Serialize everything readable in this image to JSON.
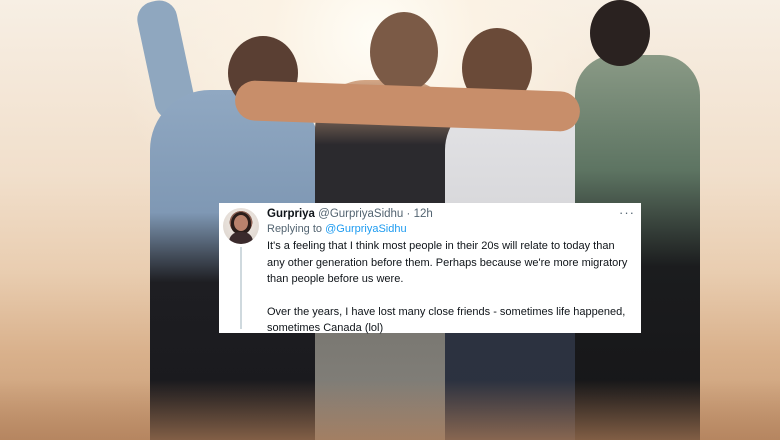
{
  "tweet": {
    "display_name": "Gurpriya",
    "handle": "@GurpriyaSidhu",
    "separator": "·",
    "time": "12h",
    "more_label": "···",
    "replying_prefix": "Replying to",
    "replying_handle": "@GurpriyaSidhu",
    "paragraph1": "It's a feeling that I think most people in their 20s will relate to today than any other generation before them. Perhaps because we're more migratory than people before us were.",
    "paragraph2": "Over the years, I have lost many close friends - sometimes life happened, sometimes Canada (lol)"
  },
  "colors": {
    "link_blue": "#1d9bf0",
    "text_primary": "#0f1419",
    "text_secondary": "#536471"
  },
  "icons": {
    "more": "more-options-icon"
  }
}
